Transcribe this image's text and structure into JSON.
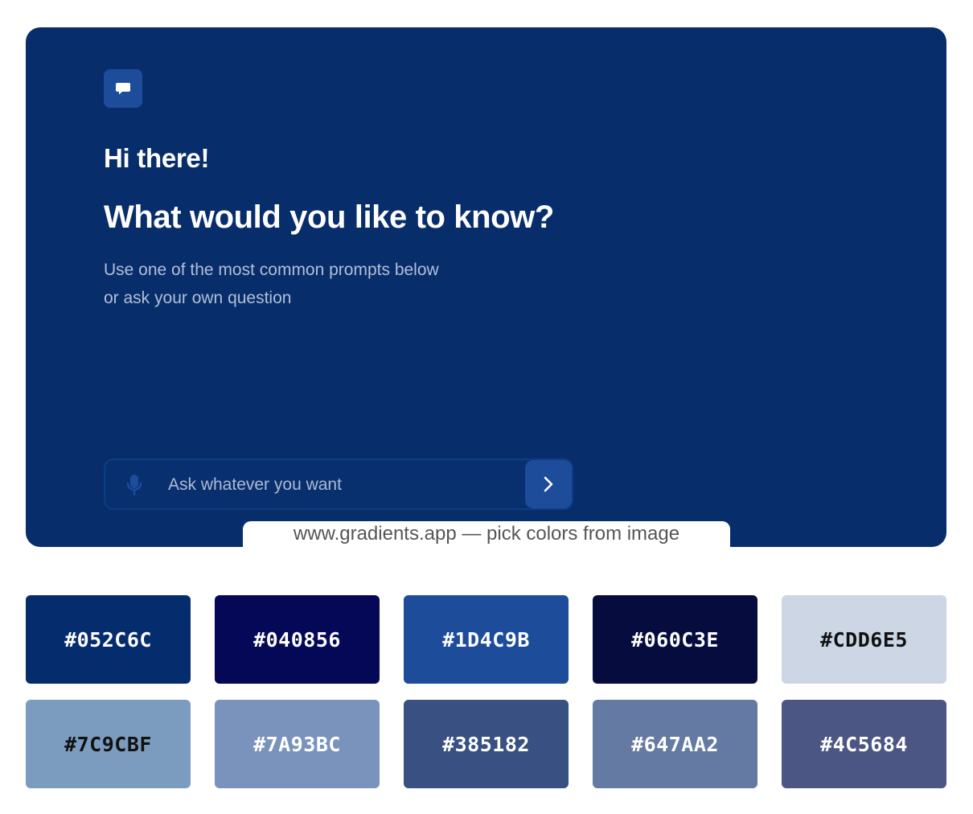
{
  "app": {
    "greeting": "Hi there!",
    "headline": "What would you like to know?",
    "subtext_lines": [
      "Use one of the most common prompts below",
      "or ask your own question"
    ],
    "input_placeholder": "Ask whatever you want",
    "icons": {
      "badge": "chat-bubble-icon",
      "mic": "microphone-icon",
      "send": "chevron-right-icon"
    },
    "colors": {
      "background": "#082d6b",
      "accent": "#1d4c9b"
    }
  },
  "watermark": "www.gradients.app — pick colors from image",
  "palette": [
    {
      "hex": "#052C6C",
      "color": "#052C6C",
      "text_color": "#ffffff"
    },
    {
      "hex": "#040856",
      "color": "#040856",
      "text_color": "#ffffff"
    },
    {
      "hex": "#1D4C9B",
      "color": "#1D4C9B",
      "text_color": "#ffffff"
    },
    {
      "hex": "#060C3E",
      "color": "#060C3E",
      "text_color": "#ffffff"
    },
    {
      "hex": "#CDD6E5",
      "color": "#CDD6E5",
      "text_color": "#111111"
    },
    {
      "hex": "#7C9CBF",
      "color": "#7C9CBF",
      "text_color": "#111111"
    },
    {
      "hex": "#7A93BC",
      "color": "#7A93BC",
      "text_color": "#ffffff"
    },
    {
      "hex": "#385182",
      "color": "#385182",
      "text_color": "#ffffff"
    },
    {
      "hex": "#647AA2",
      "color": "#647AA2",
      "text_color": "#ffffff"
    },
    {
      "hex": "#4C5684",
      "color": "#4C5684",
      "text_color": "#ffffff"
    }
  ]
}
